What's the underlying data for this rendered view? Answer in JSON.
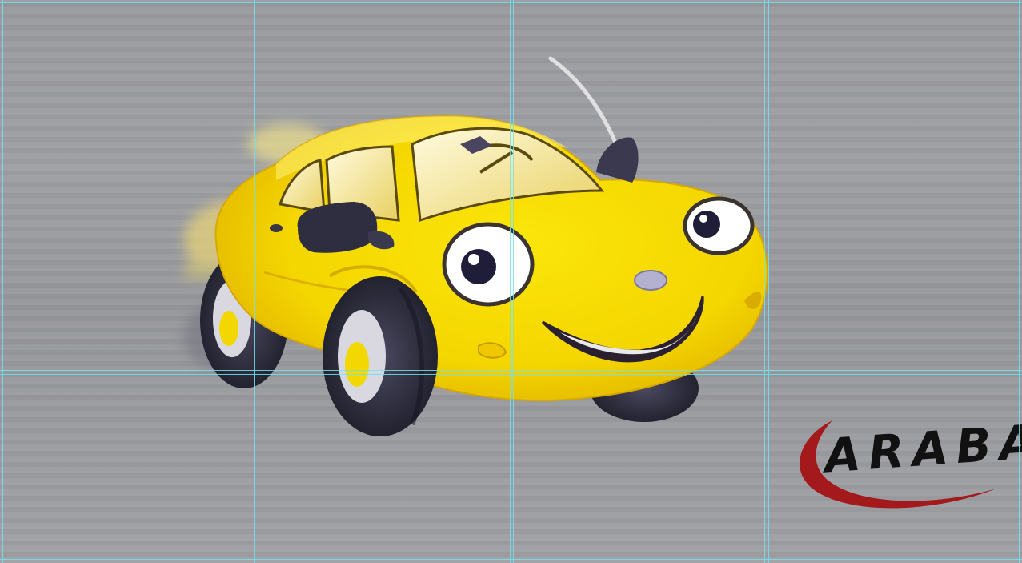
{
  "image": {
    "subject": "cartoon-yellow-car",
    "background_color": "#9c9da1",
    "car_color": "#f5dc00",
    "tire_color": "#2b2a3e"
  },
  "logo": {
    "text": "ARABA",
    "text_color": "#111111",
    "swoosh_color": "#a3191c"
  },
  "guides": {
    "color": "#6fe3ee"
  }
}
